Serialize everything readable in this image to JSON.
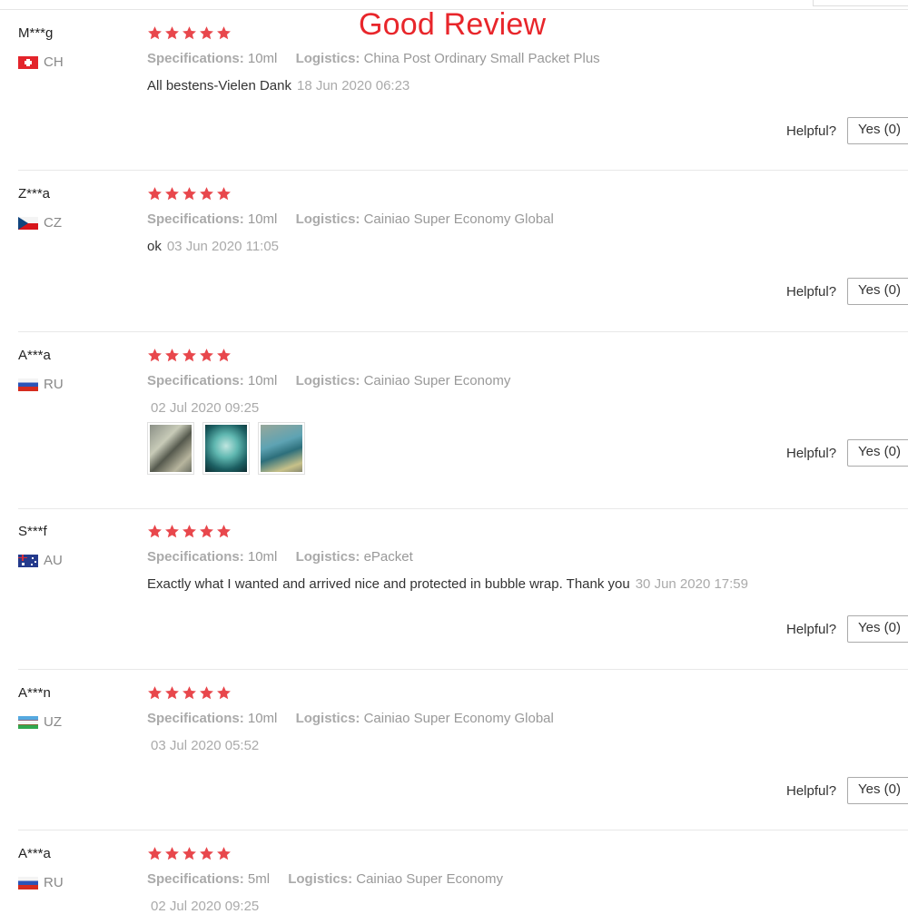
{
  "headline": "Good Review",
  "colors": {
    "star": "#e8474c",
    "headline": "#e8262b"
  },
  "labels": {
    "spec": "Specifications:",
    "logistics": "Logistics:",
    "helpful": "Helpful?",
    "yes": "Yes (0)"
  },
  "reviews": [
    {
      "user": "M***g",
      "country": "CH",
      "flag": "flag-switzerland-icon",
      "rating": 5,
      "spec": "10ml",
      "logistics": "China Post Ordinary Small Packet Plus",
      "comment": "All bestens-Vielen Dank",
      "date": "18 Jun 2020 06:23"
    },
    {
      "user": "Z***a",
      "country": "CZ",
      "flag": "flag-czech-icon",
      "rating": 5,
      "spec": "10ml",
      "logistics": "Cainiao Super Economy Global",
      "comment": "ok",
      "date": "03 Jun 2020 11:05"
    },
    {
      "user": "A***a",
      "country": "RU",
      "flag": "flag-russia-icon",
      "rating": 5,
      "spec": "10ml",
      "logistics": "Cainiao Super Economy",
      "comment": "",
      "date": "02 Jul 2020 09:25",
      "photos": 3
    },
    {
      "user": "S***f",
      "country": "AU",
      "flag": "flag-australia-icon",
      "rating": 5,
      "spec": "10ml",
      "logistics": "ePacket",
      "comment": "Exactly what I wanted and arrived nice and protected in bubble wrap. Thank you",
      "date": "30 Jun 2020 17:59"
    },
    {
      "user": "A***n",
      "country": "UZ",
      "flag": "flag-uzbekistan-icon",
      "rating": 5,
      "spec": "10ml",
      "logistics": "Cainiao Super Economy Global",
      "comment": "",
      "date": "03 Jul 2020 05:52"
    },
    {
      "user": "A***a",
      "country": "RU",
      "flag": "flag-russia-icon",
      "rating": 5,
      "spec": "5ml",
      "logistics": "Cainiao Super Economy",
      "comment": "",
      "date": "02 Jul 2020 09:25"
    }
  ]
}
